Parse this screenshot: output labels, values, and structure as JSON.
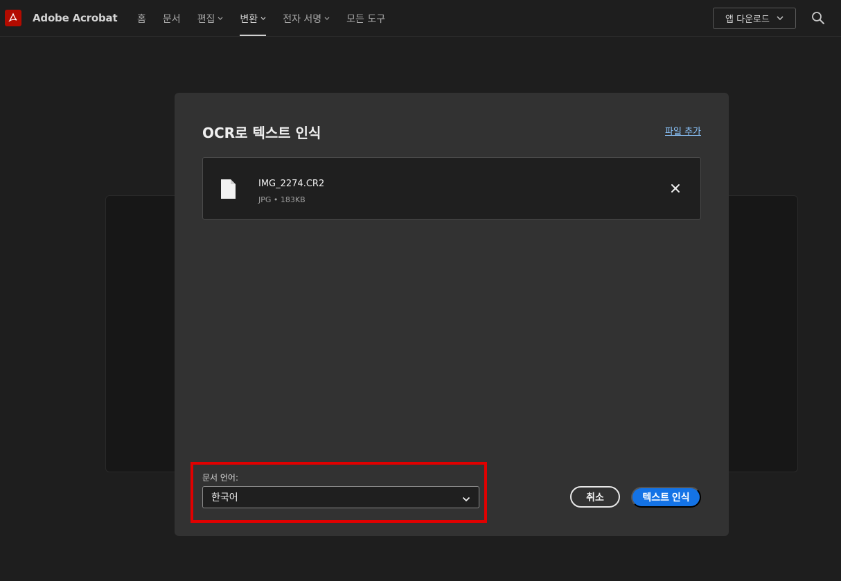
{
  "app": {
    "brand": "Adobe Acrobat"
  },
  "nav": {
    "items": [
      {
        "label": "홈",
        "dropdown": false
      },
      {
        "label": "문서",
        "dropdown": false
      },
      {
        "label": "편집",
        "dropdown": true
      },
      {
        "label": "변환",
        "dropdown": true,
        "active": true
      },
      {
        "label": "전자 서명",
        "dropdown": true
      },
      {
        "label": "모든 도구",
        "dropdown": false
      }
    ]
  },
  "header": {
    "download_label": "앱 다운로드"
  },
  "dialog": {
    "title": "OCR로 텍스트 인식",
    "add_file_label": "파일 추가",
    "file": {
      "name": "IMG_2274.CR2",
      "meta": "JPG • 183KB"
    },
    "language_label": "문서 언어:",
    "language_value": "한국어",
    "cancel_label": "취소",
    "submit_label": "텍스트 인식"
  },
  "colors": {
    "accent": "#1473e6",
    "link": "#8cc6ff",
    "highlight": "#e00000",
    "logo": "#b30b00"
  }
}
